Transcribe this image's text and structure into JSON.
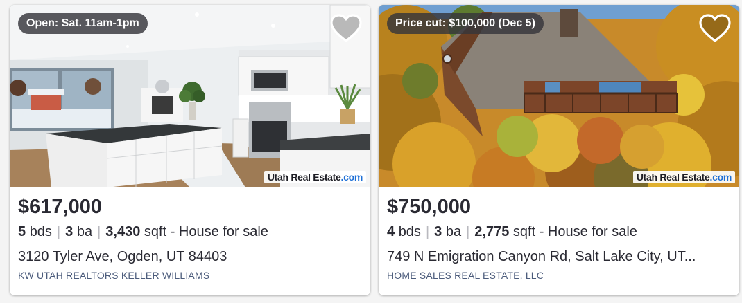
{
  "listings": [
    {
      "badge": "Open: Sat. 11am-1pm",
      "watermark_a": "Utah Real Estate",
      "watermark_b": ".com",
      "price": "$617,000",
      "beds": "5",
      "beds_unit": "bds",
      "baths": "3",
      "baths_unit": "ba",
      "sqft": "3,430",
      "sqft_unit": "sqft",
      "type_text": "- House for sale",
      "address": "3120 Tyler Ave, Ogden, UT 84403",
      "broker": "KW UTAH REALTORS KELLER WILLIAMS",
      "favorite_icon": "heart-outline-icon",
      "photo_subject": "kitchen interior"
    },
    {
      "badge": "Price cut: $100,000 (Dec 5)",
      "watermark_a": "Utah Real Estate",
      "watermark_b": ".com",
      "price": "$750,000",
      "beds": "4",
      "beds_unit": "bds",
      "baths": "3",
      "baths_unit": "ba",
      "sqft": "2,775",
      "sqft_unit": "sqft",
      "type_text": "- House for sale",
      "address": "749 N Emigration Canyon Rd, Salt Lake City, UT...",
      "broker": "HOME SALES REAL ESTATE, LLC",
      "favorite_icon": "heart-outline-icon",
      "photo_subject": "A-frame house among autumn trees"
    }
  ],
  "colors": {
    "watermark_accent": "#1d6fd6",
    "broker_text": "#4b5b7b",
    "badge_bg": "#36363a"
  }
}
